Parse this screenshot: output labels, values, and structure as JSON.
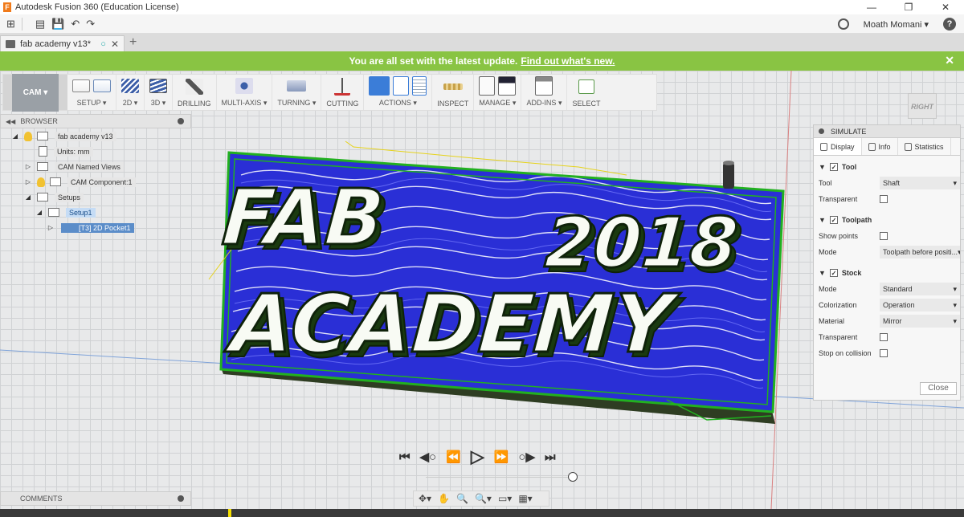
{
  "window": {
    "title": "Autodesk Fusion 360 (Education License)",
    "app_icon": "F",
    "controls": [
      "—",
      "❐",
      "✕"
    ]
  },
  "quick_access": {
    "grid_icon": "⊞",
    "file_icon": "▤",
    "save_icon": "💾",
    "undo_icon": "↶",
    "redo_icon": "↷",
    "user": "Moath Momani ▾",
    "help": "?"
  },
  "tabs": {
    "doc_title": "fab academy v13*",
    "unsaved_dot": "○",
    "close": "✕",
    "new_tab": "+"
  },
  "banner": {
    "message": "You are all set with the latest update.",
    "link": "Find out what's new.",
    "close": "✕"
  },
  "toolbar": {
    "workspace": "CAM ▾",
    "groups": [
      {
        "label": "SETUP ▾"
      },
      {
        "label": "2D ▾"
      },
      {
        "label": "3D ▾"
      },
      {
        "label": "DRILLING"
      },
      {
        "label": "MULTI-AXIS ▾"
      },
      {
        "label": "TURNING ▾"
      },
      {
        "label": "CUTTING"
      },
      {
        "label": "ACTIONS ▾"
      },
      {
        "label": "INSPECT"
      },
      {
        "label": "MANAGE ▾"
      },
      {
        "label": "ADD-INS ▾"
      },
      {
        "label": "SELECT"
      }
    ],
    "icon_colors": {
      "active": "#3b7dd8"
    }
  },
  "viewcube": {
    "face": "RIGHT"
  },
  "browser": {
    "title": "BROWSER",
    "nodes": [
      {
        "label": "fab academy v13"
      },
      {
        "label": "Units: mm"
      },
      {
        "label": "CAM Named Views"
      },
      {
        "label": "CAM Component:1"
      },
      {
        "label": "Setups"
      },
      {
        "label": "Setup1"
      },
      {
        "label": "[T3] 2D Pocket1"
      }
    ]
  },
  "simulate": {
    "title": "SIMULATE",
    "tabs": [
      "Display",
      "Info",
      "Statistics"
    ],
    "sections": {
      "tool": {
        "title": "Tool",
        "tool_label": "Tool",
        "tool_value": "Shaft",
        "transparent_label": "Transparent"
      },
      "toolpath": {
        "title": "Toolpath",
        "show_points_label": "Show points",
        "mode_label": "Mode",
        "mode_value": "Toolpath before positi..."
      },
      "stock": {
        "title": "Stock",
        "mode_label": "Mode",
        "mode_value": "Standard",
        "colorization_label": "Colorization",
        "colorization_value": "Operation",
        "material_label": "Material",
        "material_value": "Mirror",
        "transparent_label": "Transparent",
        "stop_label": "Stop on collision"
      }
    },
    "close": "Close"
  },
  "scene": {
    "line1_a": "FAB",
    "line1_b": "2018",
    "line2": "ACADEMY",
    "toolpath_color": "#2a2fd6",
    "contour_color": "#22b020",
    "stock_color": "#3a4a2a"
  },
  "playback": {
    "first": "⏮",
    "prev_op": "◀○",
    "prev": "⏪",
    "play": "▷",
    "next": "⏩",
    "next_op": "○▶",
    "last": "⏭"
  },
  "comments": {
    "title": "COMMENTS"
  },
  "navbar": {
    "items": [
      "✥▾",
      "✋",
      "🔍",
      "🔍▾",
      "▭▾",
      "▦▾"
    ]
  }
}
